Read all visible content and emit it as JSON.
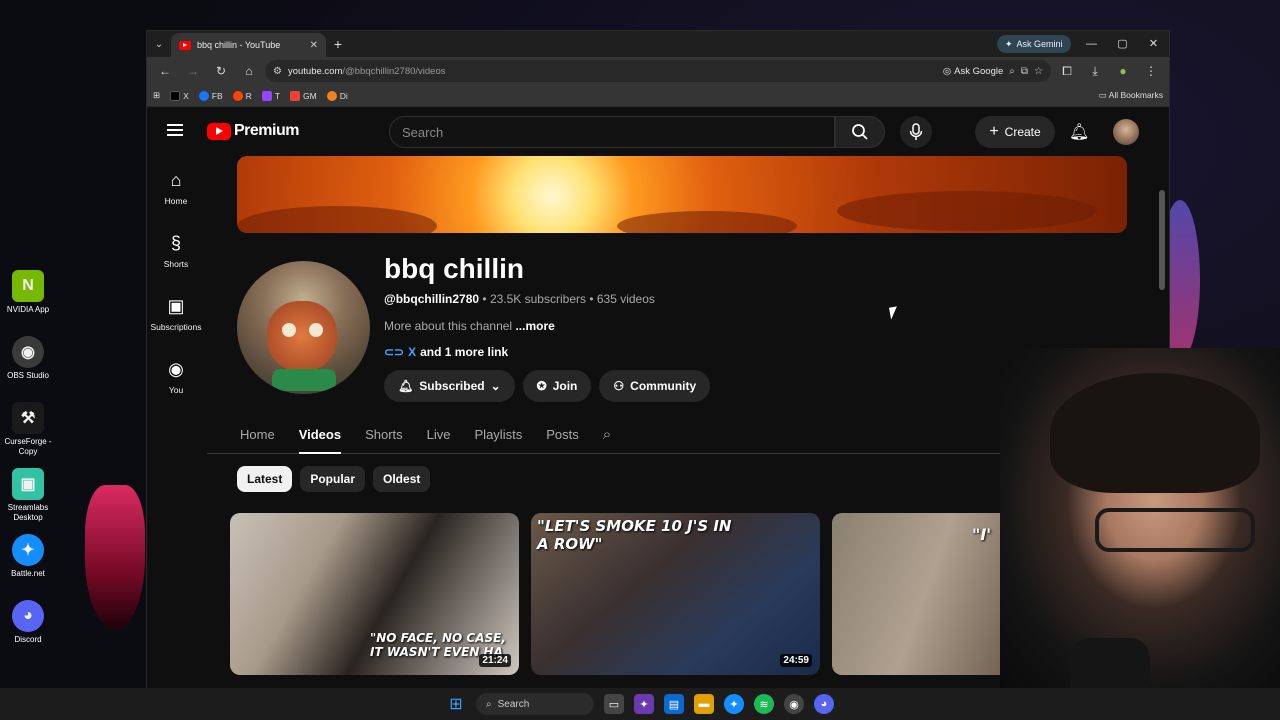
{
  "desktop": {
    "icons": [
      {
        "label": "NVIDIA App",
        "color": "#76b900",
        "glyph": "N"
      },
      {
        "label": "OBS Studio",
        "color": "#3a3a3a",
        "glyph": "◉"
      },
      {
        "label": "CurseForge - Copy",
        "color": "#1a1a1a",
        "glyph": "⚒"
      },
      {
        "label": "Streamlabs Desktop",
        "color": "#31c3a2",
        "glyph": "▣"
      },
      {
        "label": "Battle.net",
        "color": "#148eff",
        "glyph": "✦"
      },
      {
        "label": "Discord",
        "color": "#5865f2",
        "glyph": "◕"
      }
    ]
  },
  "browser": {
    "tab_title": "bbq chillin - YouTube",
    "ask_gemini": "Ask Gemini",
    "url_host": "youtube.com",
    "url_path": "/@bbqchillin2780/videos",
    "ask_google": "Ask Google",
    "bookmarks": [
      {
        "label": "X",
        "color": "#000000"
      },
      {
        "label": "FB",
        "color": "#1877f2"
      },
      {
        "label": "R",
        "color": "#ff4500"
      },
      {
        "label": "T",
        "color": "#9146ff"
      },
      {
        "label": "GM",
        "color": "#ea4335"
      },
      {
        "label": "Di",
        "color": "#f48120"
      }
    ],
    "all_bookmarks": "All Bookmarks"
  },
  "youtube": {
    "logo_text": "Premium",
    "search_placeholder": "Search",
    "create_label": "Create",
    "sidebar": [
      {
        "label": "Home",
        "icon": "home-icon",
        "glyph": "⌂"
      },
      {
        "label": "Shorts",
        "icon": "shorts-icon",
        "glyph": "§"
      },
      {
        "label": "Subscriptions",
        "icon": "subscriptions-icon",
        "glyph": "▶"
      },
      {
        "label": "You",
        "icon": "you-icon",
        "glyph": "☺"
      }
    ],
    "channel": {
      "name": "bbq chillin",
      "handle": "@bbqchillin2780",
      "subscribers": "23.5K subscribers",
      "videos": "635 videos",
      "about": "More about this channel",
      "about_more": "...more",
      "link_name": "X",
      "link_more": "and 1 more link",
      "subscribed_label": "Subscribed",
      "join_label": "Join",
      "community_label": "Community"
    },
    "tabs": [
      "Home",
      "Videos",
      "Shorts",
      "Live",
      "Playlists",
      "Posts"
    ],
    "active_tab": "Videos",
    "chips": [
      "Latest",
      "Popular",
      "Oldest"
    ],
    "active_chip": "Latest",
    "videos": [
      {
        "caption": "\"NO FACE, NO CASE, IT WASN'T EVEN HA",
        "duration": "21:24"
      },
      {
        "caption": "\"LET'S SMOKE 10 J'S IN A ROW\"",
        "duration": "24:59"
      },
      {
        "caption": "\"I'",
        "duration": ""
      }
    ]
  },
  "taskbar": {
    "search_label": "Search"
  }
}
